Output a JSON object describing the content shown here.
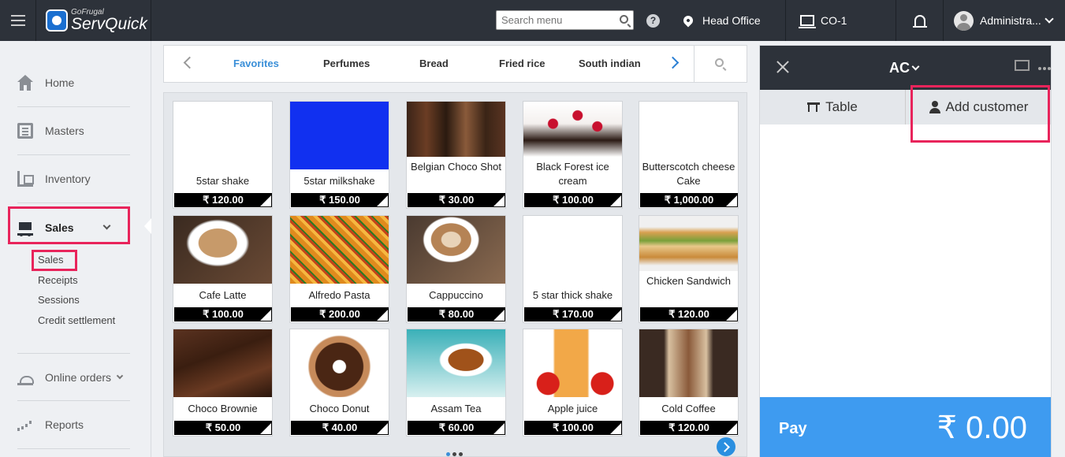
{
  "header": {
    "logo_small": "GoFrugal",
    "logo_big": "ServQuick",
    "search_placeholder": "Search menu",
    "help": "?",
    "location": "Head Office",
    "counter": "CO-1",
    "user": "Administra..."
  },
  "sidebar": {
    "items": [
      {
        "label": "Home",
        "icon": "home-icon"
      },
      {
        "label": "Masters",
        "icon": "masters-icon"
      },
      {
        "label": "Inventory",
        "icon": "inventory-icon"
      },
      {
        "label": "Sales",
        "icon": "cart-icon"
      },
      {
        "label": "Online orders",
        "icon": "online-orders-icon"
      },
      {
        "label": "Reports",
        "icon": "reports-icon"
      }
    ],
    "sales_sub": [
      "Sales",
      "Receipts",
      "Sessions",
      "Credit settlement"
    ]
  },
  "categories": [
    "Favorites",
    "Perfumes",
    "Bread",
    "Fried rice",
    "South indian"
  ],
  "products": [
    {
      "name": "5star shake",
      "price": "₹ 120.00"
    },
    {
      "name": "5star milkshake",
      "price": "₹ 150.00"
    },
    {
      "name": "Belgian Choco Shot",
      "price": "₹ 30.00"
    },
    {
      "name": "Black Forest ice cream",
      "price": "₹ 100.00"
    },
    {
      "name": "Butterscotch cheese Cake",
      "price": "₹ 1,000.00"
    },
    {
      "name": "Cafe Latte",
      "price": "₹ 100.00"
    },
    {
      "name": "Alfredo Pasta",
      "price": "₹ 200.00"
    },
    {
      "name": "Cappuccino",
      "price": "₹ 80.00"
    },
    {
      "name": "5 star thick shake",
      "price": "₹ 170.00"
    },
    {
      "name": "Chicken Sandwich",
      "price": "₹ 120.00"
    },
    {
      "name": "Choco Brownie",
      "price": "₹ 50.00"
    },
    {
      "name": "Choco Donut",
      "price": "₹ 40.00"
    },
    {
      "name": "Assam Tea",
      "price": "₹ 60.00"
    },
    {
      "name": "Apple juice",
      "price": "₹ 100.00"
    },
    {
      "name": "Cold Coffee",
      "price": "₹ 120.00"
    }
  ],
  "order": {
    "mode": "AC",
    "tab_table": "Table",
    "tab_customer": "Add customer",
    "pay_label": "Pay",
    "pay_amount": "₹ 0.00"
  },
  "colors": {
    "topbar": "#2d323a",
    "highlight": "#e8245b",
    "accent": "#3a8fd8",
    "pay": "#3e9bf0"
  }
}
